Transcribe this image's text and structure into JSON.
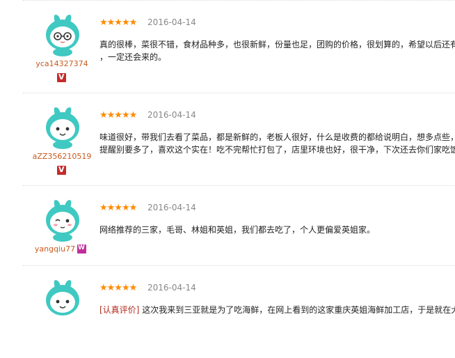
{
  "reviews": [
    {
      "username": "yca14327374",
      "date": "2016-04-14",
      "line1": "真的很棒，菜很不错，食材品种多，也很新鲜，份量也足，团购的价格，很划算的，希望以后还有",
      "line2": "，一定还会来的。",
      "badge": "v"
    },
    {
      "username": "aZZ356210519",
      "date": "2016-04-14",
      "line1": "味道很好，带我们去看了菜品，都是新鲜的，老板人很好，什么是收费的都给说明白，想多点些，",
      "line2": "提醒别要多了，喜欢这个实在！吃不完帮忙打包了，店里环境也好，很干净，下次还去你们家吃饭",
      "badge": "v"
    },
    {
      "username": "yangqiu77",
      "date": "2016-04-14",
      "line1": "网络推荐的三家，毛哥、林姐和英姐，我们都去吃了，个人更偏爱英姐家。",
      "line2": "",
      "badge": "w"
    },
    {
      "username": "",
      "date": "2016-04-14",
      "tag": "[认真评价]",
      "line1": " 这次我来到三亚就是为了吃海鲜，在网上看到的这家重庆英姐海鲜加工店，于是就在大",
      "line2": "",
      "badge": ""
    }
  ],
  "colors": {
    "stars": "#ff8a00",
    "username": "#c85a1e",
    "avatar": "#3fc9c2"
  }
}
